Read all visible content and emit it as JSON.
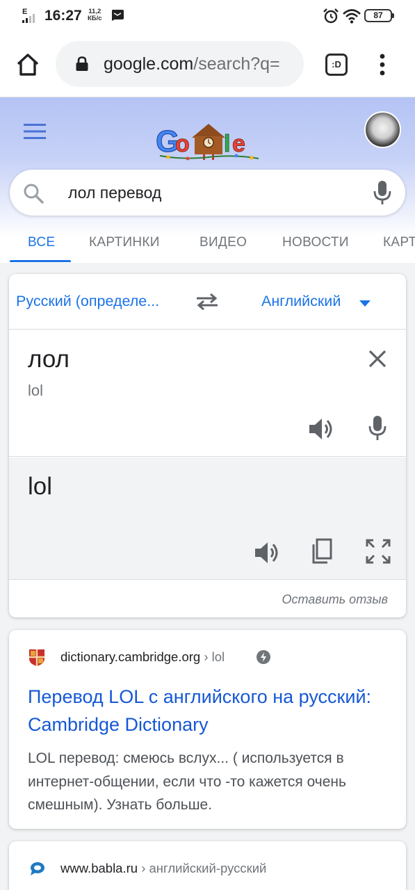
{
  "status_bar": {
    "network": "E",
    "time": "16:27",
    "speed_value": "11,2",
    "speed_unit": "КБ/с",
    "battery": "87"
  },
  "browser": {
    "url_domain": "google.com",
    "url_path": "/search?q=",
    "tabs_label": ":D"
  },
  "google": {
    "search_query": "лол перевод",
    "tabs": [
      "ВСЕ",
      "КАРТИНКИ",
      "ВИДЕО",
      "НОВОСТИ",
      "КАРТЫ"
    ]
  },
  "translate": {
    "source_lang": "Русский (определе...",
    "target_lang": "Английский",
    "source_text": "лол",
    "transliteration": "lol",
    "target_text": "lol",
    "feedback": "Оставить отзыв"
  },
  "results": [
    {
      "site": "dictionary.cambridge.org",
      "crumb": " › lol",
      "title": "Перевод LOL с английского на русский: Cambridge Dictionary",
      "snippet": "LOL перевод: смеюсь вслух... ( используется в интернет-общении, если что -то кажется очень смешным). Узнать больше."
    },
    {
      "site": "www.babla.ru",
      "crumb": " › английский-русский"
    }
  ],
  "colors": {
    "link_blue": "#1a73e8",
    "title_blue": "#1558d6",
    "header_tint": "#b4c3f5"
  }
}
